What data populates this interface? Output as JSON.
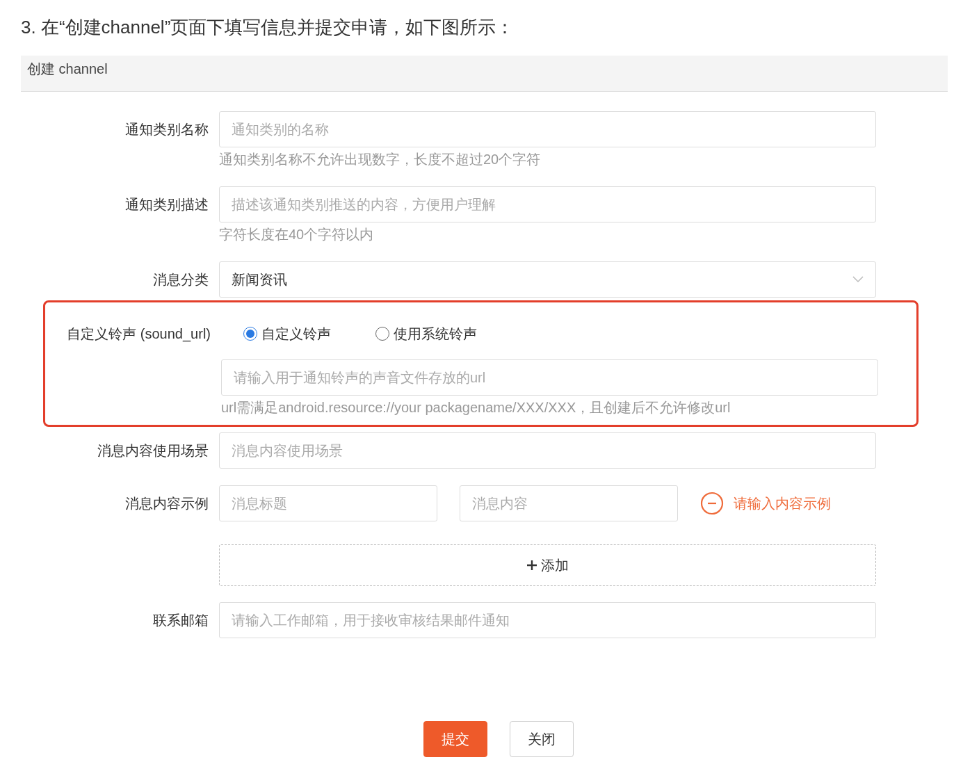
{
  "heading": "3. 在“创建channel”页面下填写信息并提交申请，如下图所示：",
  "panel_title": "创建 channel",
  "fields": [
    {
      "kind": "text",
      "label": "通知类别名称",
      "placeholder": "通知类别的名称",
      "help": "通知类别名称不允许出现数字，长度不超过20个字符"
    },
    {
      "kind": "text",
      "label": "通知类别描述",
      "placeholder": "描述该通知类别推送的内容，方便用户理解",
      "help": "字符长度在40个字符以内"
    },
    {
      "kind": "select",
      "label": "消息分类",
      "value": "新闻资讯"
    },
    {
      "kind": "sound",
      "label": "自定义铃声 (sound_url)",
      "highlighted": true,
      "options": [
        {
          "label": "自定义铃声",
          "selected": true
        },
        {
          "label": "使用系统铃声",
          "selected": false
        }
      ],
      "placeholder": "请输入用于通知铃声的声音文件存放的url",
      "help": "url需满足android.resource://your packagename/XXX/XXX，且创建后不允许修改url"
    },
    {
      "kind": "text",
      "label": "消息内容使用场景",
      "placeholder": "消息内容使用场景"
    },
    {
      "kind": "pair",
      "label": "消息内容示例",
      "placeholders": [
        "消息标题",
        "消息内容"
      ],
      "action": "请输入内容示例"
    },
    {
      "kind": "add",
      "label": "添加"
    },
    {
      "kind": "text",
      "label": "联系邮箱",
      "placeholder": "请输入工作邮箱，用于接收审核结果邮件通知"
    }
  ],
  "buttons": [
    {
      "label": "提交",
      "kind": "primary"
    },
    {
      "label": "关闭",
      "kind": "default"
    }
  ]
}
